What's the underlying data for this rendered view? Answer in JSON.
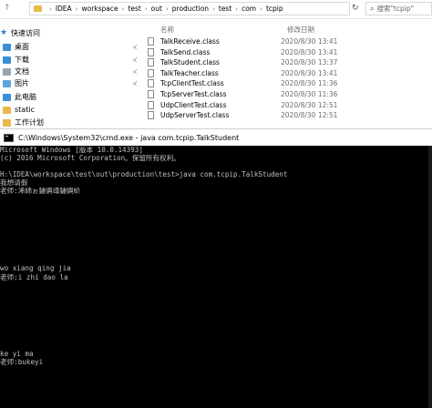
{
  "explorer": {
    "breadcrumb": [
      "IDEA",
      "workspace",
      "test",
      "out",
      "production",
      "test",
      "com",
      "tcpip"
    ],
    "search_placeholder": "搜索\"tcpip\"",
    "quick_access": "快速访问",
    "nav_items": [
      {
        "label": "桌面",
        "icon": "desktop-icon",
        "color": "#3b8fd9"
      },
      {
        "label": "下载",
        "icon": "download-icon",
        "color": "#3b8fd9"
      },
      {
        "label": "文档",
        "icon": "documents-icon",
        "color": "#9aa4b1"
      },
      {
        "label": "图片",
        "icon": "pictures-icon",
        "color": "#5aa4e0"
      },
      {
        "label": "此电脑",
        "icon": "this-pc-icon",
        "color": "#3b8fd9"
      },
      {
        "label": "static",
        "icon": "folder-icon",
        "color": "#e8b84b"
      },
      {
        "label": "工作计划",
        "icon": "folder-icon",
        "color": "#e8b84b"
      }
    ],
    "columns": {
      "name": "名称",
      "date": "修改日期"
    },
    "files": [
      {
        "name": "TalkReceive.class",
        "date": "2020/8/30 13:41"
      },
      {
        "name": "TalkSend.class",
        "date": "2020/8/30 13:41"
      },
      {
        "name": "TalkStudent.class",
        "date": "2020/8/30 13:37"
      },
      {
        "name": "TalkTeacher.class",
        "date": "2020/8/30 13:41"
      },
      {
        "name": "TcpClientTest.class",
        "date": "2020/8/30 11:36"
      },
      {
        "name": "TcpServerTest.class",
        "date": "2020/8/30 11:36"
      },
      {
        "name": "UdpClientTest.class",
        "date": "2020/8/30 12:51"
      },
      {
        "name": "UdpServerTest.class",
        "date": "2020/8/30 12:51"
      }
    ]
  },
  "cmd": {
    "title": "C:\\Windows\\System32\\cmd.exe - java  com.tcpip.TalkStudent",
    "lines": [
      {
        "text": "Microsoft Windows [版本 10.0.14393]"
      },
      {
        "text": "(c) 2016 Microsoft Corporation。保留所有权利。"
      },
      {
        "text": ""
      },
      {
        "text": "H:\\IDEA\\workspace\\test\\out\\production\\test>java com.tcpip.TalkStudent"
      },
      {
        "text": "我想请假"
      },
      {
        "text": "老师:浠婂ぉ鐪嬩竴鐪嬩紒"
      },
      {
        "text": "wo xiang qing jia"
      },
      {
        "text": "老师:i zhi dao la"
      },
      {
        "text": "ke yi ma"
      },
      {
        "text": "老师:bukeyi"
      }
    ]
  }
}
